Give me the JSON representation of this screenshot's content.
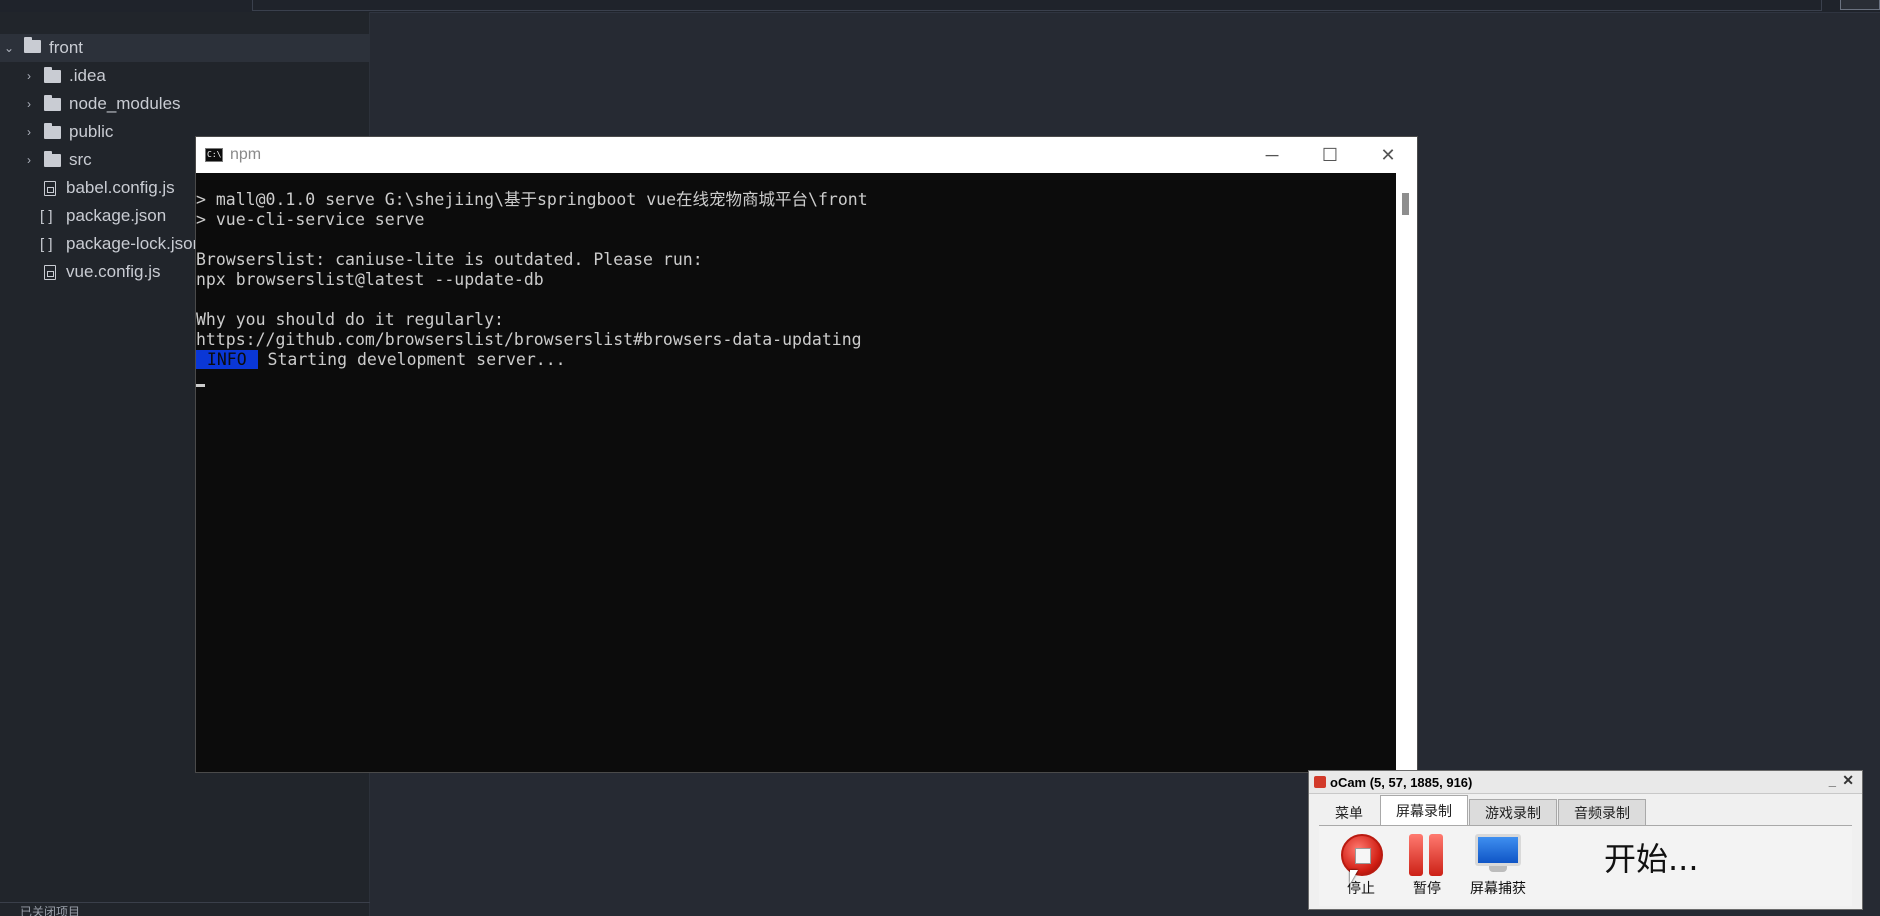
{
  "sidebar": {
    "root": "front",
    "items": [
      {
        "label": ".idea",
        "kind": "folder"
      },
      {
        "label": "node_modules",
        "kind": "folder"
      },
      {
        "label": "public",
        "kind": "folder"
      },
      {
        "label": "src",
        "kind": "folder"
      },
      {
        "label": "babel.config.js",
        "kind": "js"
      },
      {
        "label": "package.json",
        "kind": "json"
      },
      {
        "label": "package-lock.json",
        "kind": "json"
      },
      {
        "label": "vue.config.js",
        "kind": "js"
      }
    ],
    "bottom_text": "已关闭项目"
  },
  "npm_window": {
    "title": "npm",
    "icon_text": "C:\\.",
    "controls": {
      "minimize": "─",
      "maximize": "☐",
      "close": "✕"
    },
    "lines": [
      "> mall@0.1.0 serve G:\\shejiing\\基于springboot vue在线宠物商城平台\\front",
      "> vue-cli-service serve",
      "",
      "Browserslist: caniuse-lite is outdated. Please run:",
      "npx browserslist@latest --update-db",
      "",
      "Why you should do it regularly:",
      "https://github.com/browserslist/browserslist#browsers-data-updating"
    ],
    "info_tag": " INFO ",
    "info_text": " Starting development server..."
  },
  "ocam": {
    "title": "oCam (5, 57, 1885, 916)",
    "tabs": [
      "菜单",
      "屏幕录制",
      "游戏录制",
      "音频录制"
    ],
    "active_tab": 1,
    "buttons": {
      "stop": "停止",
      "pause": "暂停",
      "capture": "屏幕捕获"
    },
    "status": "开始..."
  },
  "colors": {
    "info_tag": "#0a37d6",
    "console_bg": "#0c0c0c",
    "ide_bg": "#262a33"
  }
}
